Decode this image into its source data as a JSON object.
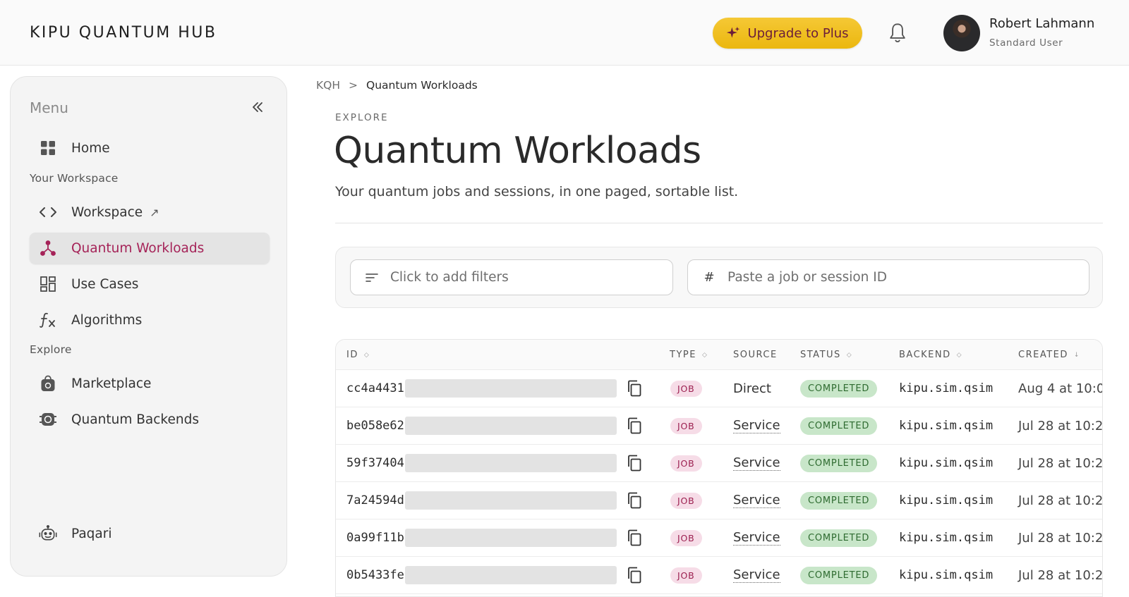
{
  "header": {
    "logo": "KIPU QUANTUM HUB",
    "upgrade_label": "Upgrade to Plus",
    "user_name": "Robert Lahmann",
    "user_role": "Standard User"
  },
  "sidebar": {
    "menu_title": "Menu",
    "items": [
      {
        "label": "Home",
        "icon": "grid-icon"
      },
      {
        "label": "Workspace",
        "icon": "code-icon"
      },
      {
        "label": "Quantum Workloads",
        "icon": "network-icon"
      },
      {
        "label": "Use Cases",
        "icon": "dashboard-icon"
      },
      {
        "label": "Algorithms",
        "icon": "function-icon"
      },
      {
        "label": "Marketplace",
        "icon": "shopping-bag-icon"
      },
      {
        "label": "Quantum Backends",
        "icon": "chip-icon"
      },
      {
        "label": "Paqari",
        "icon": "robot-icon"
      }
    ],
    "sections": [
      "Your Workspace",
      "Explore"
    ],
    "workspace_external": "↗"
  },
  "breadcrumb": {
    "root": "KQH",
    "separator": ">",
    "current": "Quantum Workloads"
  },
  "main": {
    "eyebrow": "EXPLORE",
    "title": "Quantum Workloads",
    "subtitle": "Your quantum jobs and sessions, in one paged, sortable list.",
    "filter_placeholder": "Click to add filters",
    "id_hash": "#",
    "id_placeholder": "Paste a job or session ID"
  },
  "table": {
    "columns": [
      "ID",
      "TYPE",
      "SOURCE",
      "STATUS",
      "BACKEND",
      "CREATED"
    ],
    "sort_icons": {
      "neutral": "◇",
      "desc": "↓"
    },
    "rows": [
      {
        "id": "cc4a4431",
        "type": "JOB",
        "source": "Direct",
        "status": "COMPLETED",
        "backend": "kipu.sim.qsim",
        "created": "Aug 4 at 10:0"
      },
      {
        "id": "be058e62",
        "type": "JOB",
        "source": "Service",
        "status": "COMPLETED",
        "backend": "kipu.sim.qsim",
        "created": "Jul 28 at 10:2"
      },
      {
        "id": "59f37404",
        "type": "JOB",
        "source": "Service",
        "status": "COMPLETED",
        "backend": "kipu.sim.qsim",
        "created": "Jul 28 at 10:2"
      },
      {
        "id": "7a24594d",
        "type": "JOB",
        "source": "Service",
        "status": "COMPLETED",
        "backend": "kipu.sim.qsim",
        "created": "Jul 28 at 10:2"
      },
      {
        "id": "0a99f11b",
        "type": "JOB",
        "source": "Service",
        "status": "COMPLETED",
        "backend": "kipu.sim.qsim",
        "created": "Jul 28 at 10:2"
      },
      {
        "id": "0b5433fe",
        "type": "JOB",
        "source": "Service",
        "status": "COMPLETED",
        "backend": "kipu.sim.qsim",
        "created": "Jul 28 at 10:2"
      }
    ]
  },
  "colors": {
    "accent": "#a52358",
    "upgrade": "#f2c12e",
    "completed_bg": "#c8e6c9",
    "job_bg": "#f6dce7"
  }
}
